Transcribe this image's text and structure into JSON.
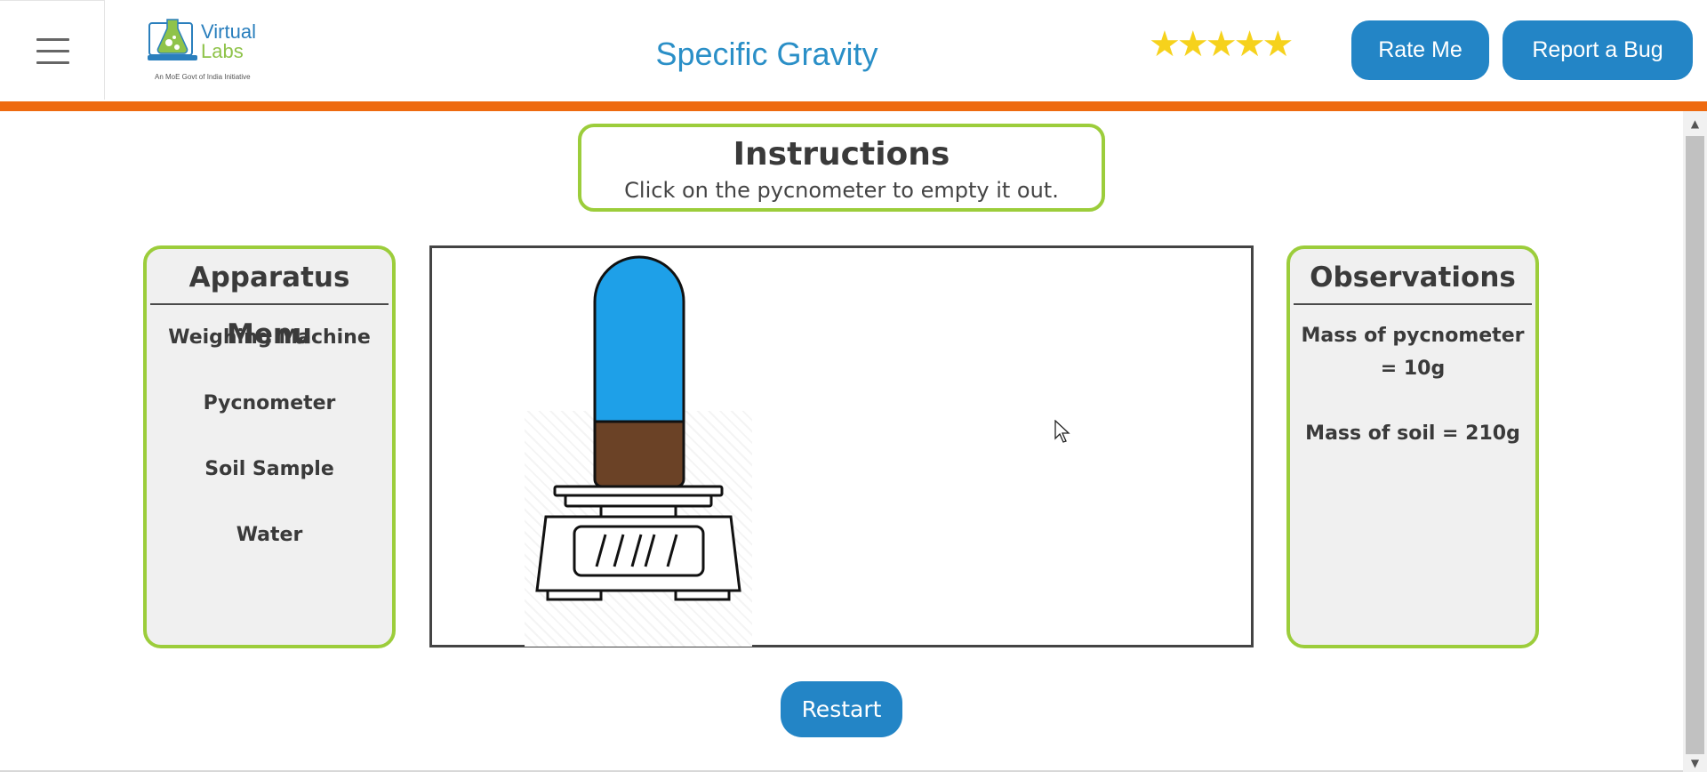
{
  "header": {
    "logo_word1": "Virtual",
    "logo_word2": "Labs",
    "logo_tagline": "An MoE Govt of India Initiative",
    "title": "Specific Gravity",
    "rating_stars": "★★★★★",
    "rating_value": 5,
    "rating_max": 5,
    "rate_label": "Rate Me",
    "bug_label": "Report a Bug",
    "accent_color": "#ee6a10",
    "brand_blue": "#2385c6"
  },
  "instructions": {
    "title": "Instructions",
    "text": "Click on the pycnometer to empty it out."
  },
  "apparatus_menu": {
    "title": "Apparatus Menu",
    "items": [
      "Weighing Machine",
      "Pycnometer",
      "Soil Sample",
      "Water"
    ]
  },
  "observations": {
    "title": "Observations",
    "items": [
      "Mass of pycnometer = 10g",
      "Mass of soil = 210g"
    ]
  },
  "workspace": {
    "pycnometer_liquid_color": "#1ea0e8",
    "soil_color": "#6b4226"
  },
  "controls": {
    "restart_label": "Restart"
  },
  "colors": {
    "panel_border": "#9ccd3b",
    "star": "#f6d21c"
  }
}
